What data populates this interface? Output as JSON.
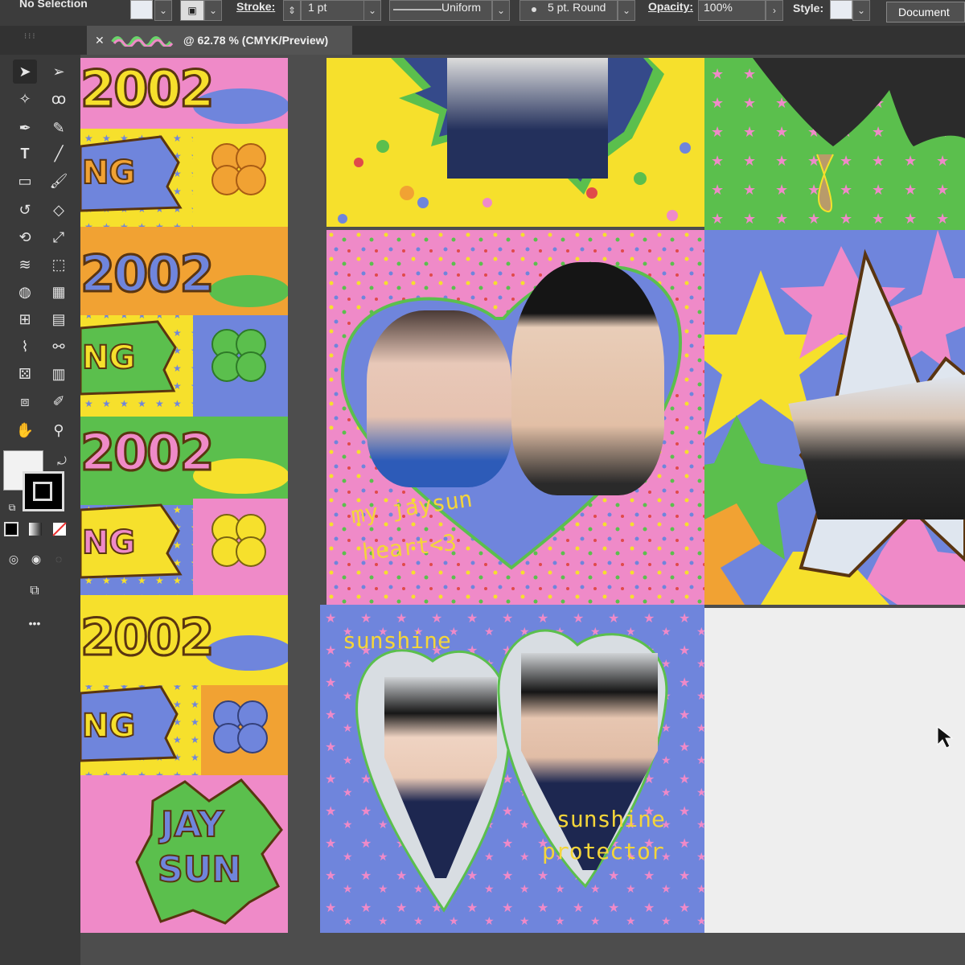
{
  "control_bar": {
    "selection_label": "No Selection",
    "stroke_label": "Stroke:",
    "stroke_value": "1 pt",
    "profile_value": "Uniform",
    "brush_value": "5 pt. Round",
    "opacity_label": "Opacity:",
    "opacity_value": "100%",
    "style_label": "Style:",
    "document_setup_label": "Document S"
  },
  "document_tab": {
    "title": "@ 62.78 % (CMYK/Preview)"
  },
  "toolbar": {
    "tools": [
      "selection-tool",
      "direct-selection-tool",
      "magic-wand-tool",
      "lasso-tool",
      "pen-tool",
      "curvature-tool",
      "type-tool",
      "line-tool",
      "rectangle-tool",
      "paintbrush-tool",
      "shaper-tool",
      "eraser-tool",
      "rotate-tool",
      "scale-tool",
      "width-tool",
      "free-transform-tool",
      "shape-builder-tool",
      "perspective-grid-tool",
      "mesh-tool",
      "gradient-tool",
      "eyedropper-tool",
      "blend-tool",
      "symbol-sprayer-tool",
      "column-graph-tool",
      "artboard-tool",
      "slice-tool",
      "hand-tool",
      "zoom-tool"
    ],
    "more_label": "•••"
  },
  "artwork": {
    "year_label": "2002",
    "ing_label": "NG",
    "jaysun_label": [
      "JAY",
      "SUN"
    ],
    "heart_caption": [
      "my jaysun",
      "heart<3"
    ],
    "sunshine_label": "sunshine",
    "protector_caption": [
      "sunshine",
      "protector"
    ]
  },
  "colors": {
    "yellow": "#f6e02c",
    "pink": "#ef8ac8",
    "blue": "#6f85dc",
    "green": "#5bbf4d",
    "orange": "#f1a233"
  }
}
